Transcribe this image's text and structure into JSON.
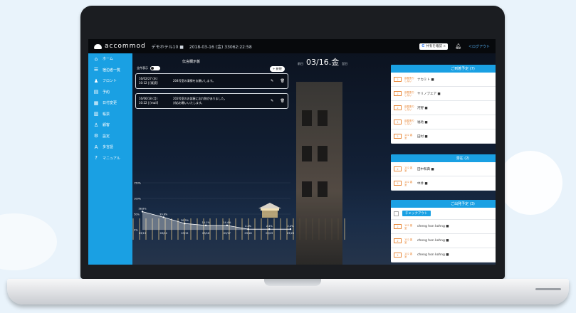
{
  "app": {
    "logo_text": "accommod",
    "hotel": "デモホテル10 ■",
    "datetime": "2018-03-16 (金) 33062:22:58",
    "google_btn": "共有を確認 ×",
    "logout": "＜ログアウト"
  },
  "sidebar": {
    "items": [
      {
        "icon": "home-icon",
        "glyph": "⌂",
        "label": "ホーム"
      },
      {
        "icon": "list-icon",
        "glyph": "☰",
        "label": "宿泊者一覧"
      },
      {
        "icon": "front-icon",
        "glyph": "♟",
        "label": "フロント"
      },
      {
        "icon": "reservation-icon",
        "glyph": "▤",
        "label": "予約"
      },
      {
        "icon": "report-icon",
        "glyph": "▦",
        "label": "日付変更"
      },
      {
        "icon": "calendar-icon",
        "glyph": "▥",
        "label": "帳票"
      },
      {
        "icon": "user-icon",
        "glyph": "♙",
        "label": "顧客"
      },
      {
        "icon": "gear-icon",
        "glyph": "⚙",
        "label": "設定"
      },
      {
        "icon": "translate-icon",
        "glyph": "A",
        "label": "多言語"
      },
      {
        "icon": "help-icon",
        "glyph": "?",
        "label": "マニュアル"
      }
    ]
  },
  "datebar": {
    "prev": "前日",
    "date": "03/16.金",
    "next": "翌日"
  },
  "messages": {
    "title": "伝言欄示板",
    "toggle_label": "全件表示",
    "new_label": "+ 新規",
    "items": [
      {
        "meta1": "16/02/27 (木)",
        "meta2": "10:12 | [既読]",
        "text": "204号室の清掃をお願いします。"
      },
      {
        "meta1": "16/06/18 (月)",
        "meta2": "10:22 | [mail]",
        "text": "202号室のお部屋に忘れ物がありました。",
        "text2": "対応お願いいたします。"
      }
    ]
  },
  "chart_data": {
    "type": "area",
    "categories": [
      "03/13",
      "03/14",
      "03/15",
      "03/16",
      "03/17",
      "03/18",
      "03/19",
      "03/20"
    ],
    "series": [
      {
        "values": [
          58,
          40,
          20,
          14,
          14,
          2,
          2,
          2
        ]
      }
    ],
    "ylim": [
      0,
      150
    ],
    "y_ticks": [
      "0%",
      "50%",
      "100%",
      "150%"
    ],
    "point_labels": [
      "58.8%",
      "39.6%",
      "20.3%",
      "14.1%",
      "14.4%",
      "2.4%",
      "2.4%",
      "2.4%"
    ]
  },
  "panels": {
    "arrivals": {
      "title": "ご到着予定 (7)",
      "more": "全て",
      "rows": [
        {
          "badge": "2",
          "tag": "部屋割りしない",
          "name": "ナカミト ■",
          "date": "3月16日 3泊",
          "sub": "2017/5/10"
        },
        {
          "badge": "2",
          "tag": "部屋割りしない",
          "name": "ヤリノブエア ■",
          "date": "3月16日 3泊",
          "sub": "2017/5/10"
        },
        {
          "badge": "2",
          "tag": "部屋割りしない",
          "name": "河野 ■",
          "date": "3月16日 3泊",
          "sub": "2017/5/10"
        },
        {
          "badge": "1",
          "tag": "部屋割りしない",
          "name": "福地 ■",
          "date": "3月16日 3泊",
          "sub": "2017/5/10"
        },
        {
          "badge": "2",
          "tag": "102 客室",
          "name": "田村 ■",
          "date": "3月16日 3泊",
          "sub": "2017/5/10"
        }
      ]
    },
    "staying": {
      "title": "滞在 (2)",
      "more": "全て",
      "rows": [
        {
          "badge": "2",
          "tag": "102 客室",
          "name": "田中和典 ■",
          "date": "3月 1泊",
          "sub": "2017/5/2"
        },
        {
          "badge": "2",
          "tag": "102 客室",
          "name": "中井 ■",
          "date": "3月 1泊",
          "sub": "2017/5/1"
        }
      ]
    },
    "departures": {
      "title": "ご出発予定 (3)",
      "checkout_label": "チェックアウト",
      "rows": [
        {
          "badge": "2",
          "tag": "102 客室",
          "name": "cheng hon kohng ■",
          "date": "3月 1泊",
          "sub": "¥3,000"
        },
        {
          "badge": "2",
          "tag": "102 客室",
          "name": "cheng hon kohng ■",
          "date": "3月 1泊",
          "sub": "¥3,000"
        },
        {
          "badge": "2",
          "tag": "102 客室",
          "name": "cheng hon kohng ■",
          "date": "3月 1泊",
          "sub": "¥10,000"
        }
      ]
    }
  }
}
